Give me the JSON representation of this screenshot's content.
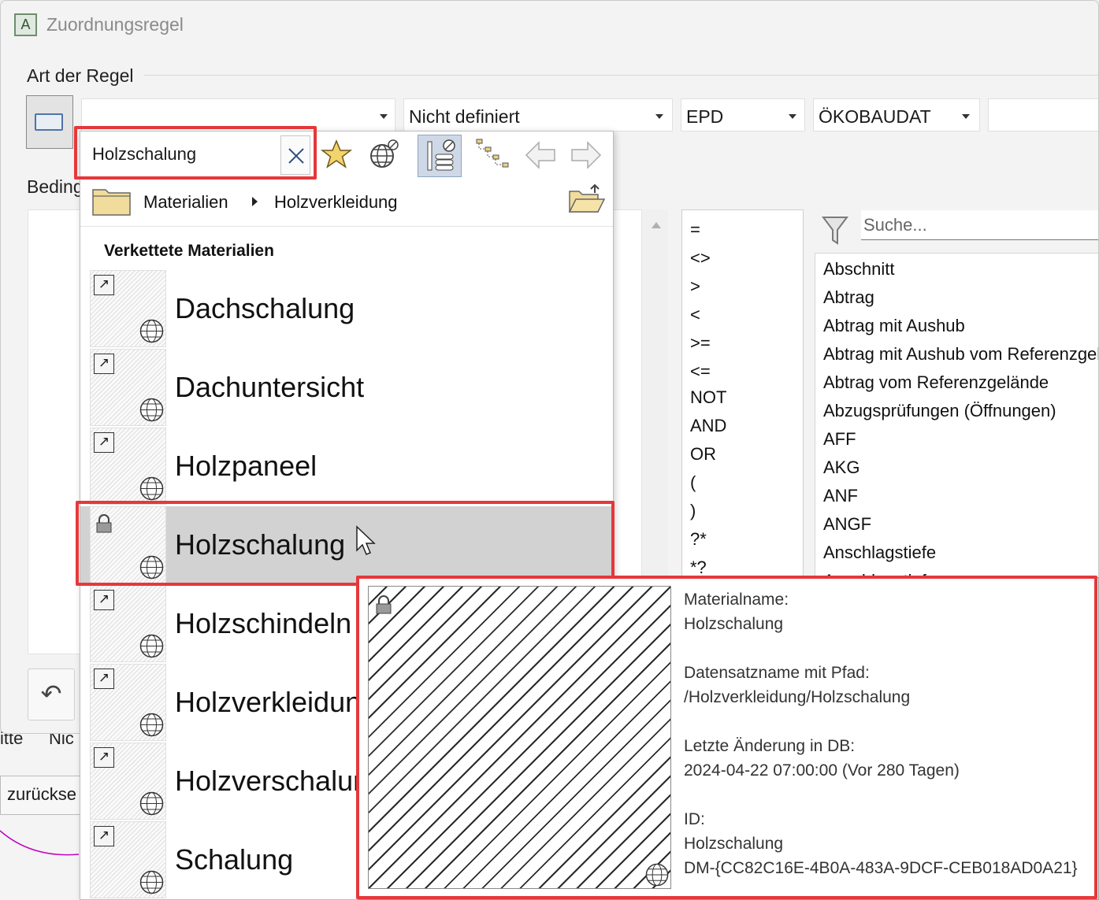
{
  "background": {
    "col_a": "itte",
    "col_b": "Nic",
    "reset_button": "zurückse"
  },
  "dialog": {
    "title": "Zuordnungsregel",
    "app_icon_letter": "A",
    "group_rule_type": "Art der Regel",
    "group_conditions": "Beding",
    "combos": [
      {
        "value": ""
      },
      {
        "value": "Nicht definiert"
      },
      {
        "value": "EPD"
      },
      {
        "value": "ÖKOBAUDAT"
      },
      {
        "value": ""
      }
    ],
    "undo_glyph": "↶",
    "operators": [
      "=",
      "<>",
      ">",
      "<",
      ">=",
      "<=",
      "NOT",
      "AND",
      "OR",
      "(",
      ")",
      "?*",
      "*?"
    ],
    "attr_search_placeholder": "Suche...",
    "attributes": [
      "Abschnitt",
      "Abtrag",
      "Abtrag mit Aushub",
      "Abtrag mit Aushub vom Referenzgelände",
      "Abtrag vom Referenzgelände",
      "Abzugsprüfungen (Öffnungen)",
      "AFF",
      "AKG",
      "ANF",
      "ANGF",
      "Anschlagstiefe",
      "Anschlagstiefe"
    ]
  },
  "browser": {
    "search_value": "Holzschalung",
    "breadcrumb": [
      "Materialien",
      "Holzverkleidung"
    ],
    "section_title": "Verkettete Materialien",
    "link_glyph": "↗",
    "materials": [
      {
        "name": "Dachschalung",
        "kind": "link"
      },
      {
        "name": "Dachuntersicht",
        "kind": "link"
      },
      {
        "name": "Holzpaneel",
        "kind": "link"
      },
      {
        "name": "Holzschalung",
        "kind": "locked",
        "selected": true
      },
      {
        "name": "Holzschindeln",
        "kind": "link"
      },
      {
        "name": "Holzverkleidung",
        "kind": "link"
      },
      {
        "name": "Holzverschalung",
        "kind": "link"
      },
      {
        "name": "Schalung",
        "kind": "link"
      }
    ]
  },
  "tooltip": {
    "material_name_label": "Materialname:",
    "material_name": "Holzschalung",
    "path_label": "Datensatzname mit Pfad:",
    "path": "/Holzverkleidung/Holzschalung",
    "changed_label": "Letzte Änderung in DB:",
    "changed": "2024-04-22 07:00:00 (Vor 280 Tagen)",
    "id_label": "ID:",
    "id_name": "Holzschalung",
    "id_guid": "DM-{CC82C16E-4B0A-483A-9DCF-CEB018AD0A21}"
  },
  "colors": {
    "highlight": "#e5383b",
    "selection": "#d2d2d2",
    "toolbar_active": "#cfd8e6"
  }
}
